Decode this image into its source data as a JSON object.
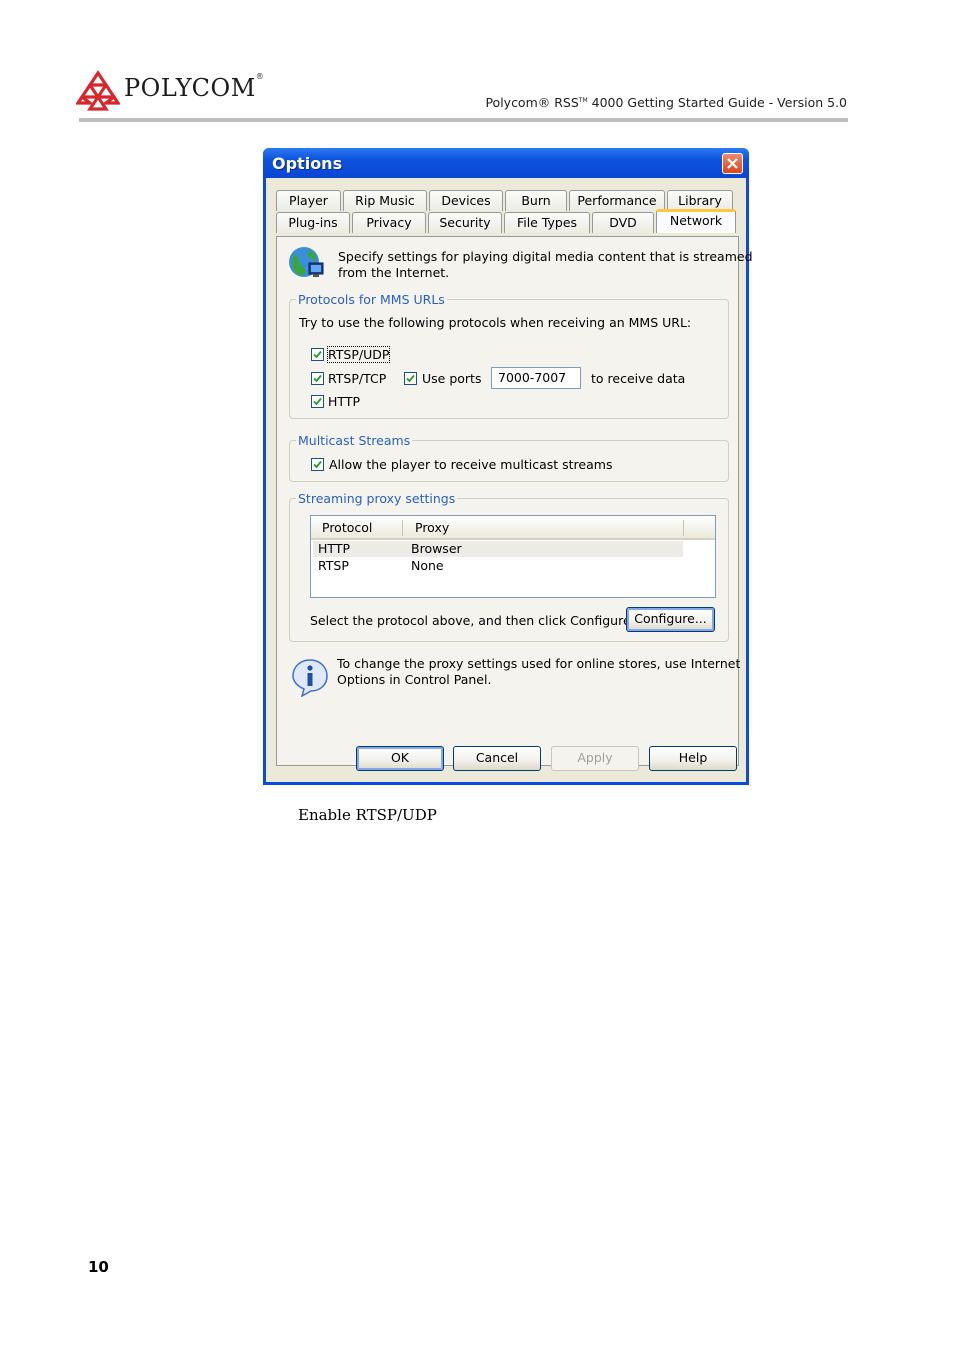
{
  "header": {
    "brand": "POLYCOM",
    "doc_title_prefix": "Polycom® RSS",
    "doc_title_tm": "TM",
    "doc_title_suffix": " 4000 Getting Started Guide - Version 5.0"
  },
  "dialog": {
    "title": "Options",
    "tabs_row1": [
      "Player",
      "Rip Music",
      "Devices",
      "Burn",
      "Performance",
      "Library"
    ],
    "tabs_row2": [
      "Plug-ins",
      "Privacy",
      "Security",
      "File Types",
      "DVD",
      "Network"
    ],
    "active_tab": "Network",
    "intro_line1": "Specify settings for playing digital media content that is streamed",
    "intro_line2": "from the Internet.",
    "protocols": {
      "group_label": "Protocols for MMS URLs",
      "description": "Try to use the following protocols when receiving an MMS URL:",
      "rtsp_udp": "RTSP/UDP",
      "rtsp_tcp": "RTSP/TCP",
      "use_ports": "Use ports",
      "ports_value": "7000-7007",
      "to_receive": "to receive data",
      "http": "HTTP"
    },
    "multicast": {
      "group_label": "Multicast Streams",
      "allow": "Allow the player to receive multicast streams"
    },
    "proxy": {
      "group_label": "Streaming proxy settings",
      "columns": [
        "Protocol",
        "Proxy"
      ],
      "rows": [
        {
          "protocol": "HTTP",
          "proxy": "Browser"
        },
        {
          "protocol": "RTSP",
          "proxy": "None"
        }
      ],
      "select_hint": "Select the protocol above, and then click Configure.",
      "configure_label": "Configure..."
    },
    "info_line1": "To change the proxy settings used for online stores, use Internet",
    "info_line2": "Options in Control Panel.",
    "buttons": {
      "ok": "OK",
      "cancel": "Cancel",
      "apply": "Apply",
      "help": "Help"
    }
  },
  "caption": "Enable RTSP/UDP",
  "page_number": "10"
}
